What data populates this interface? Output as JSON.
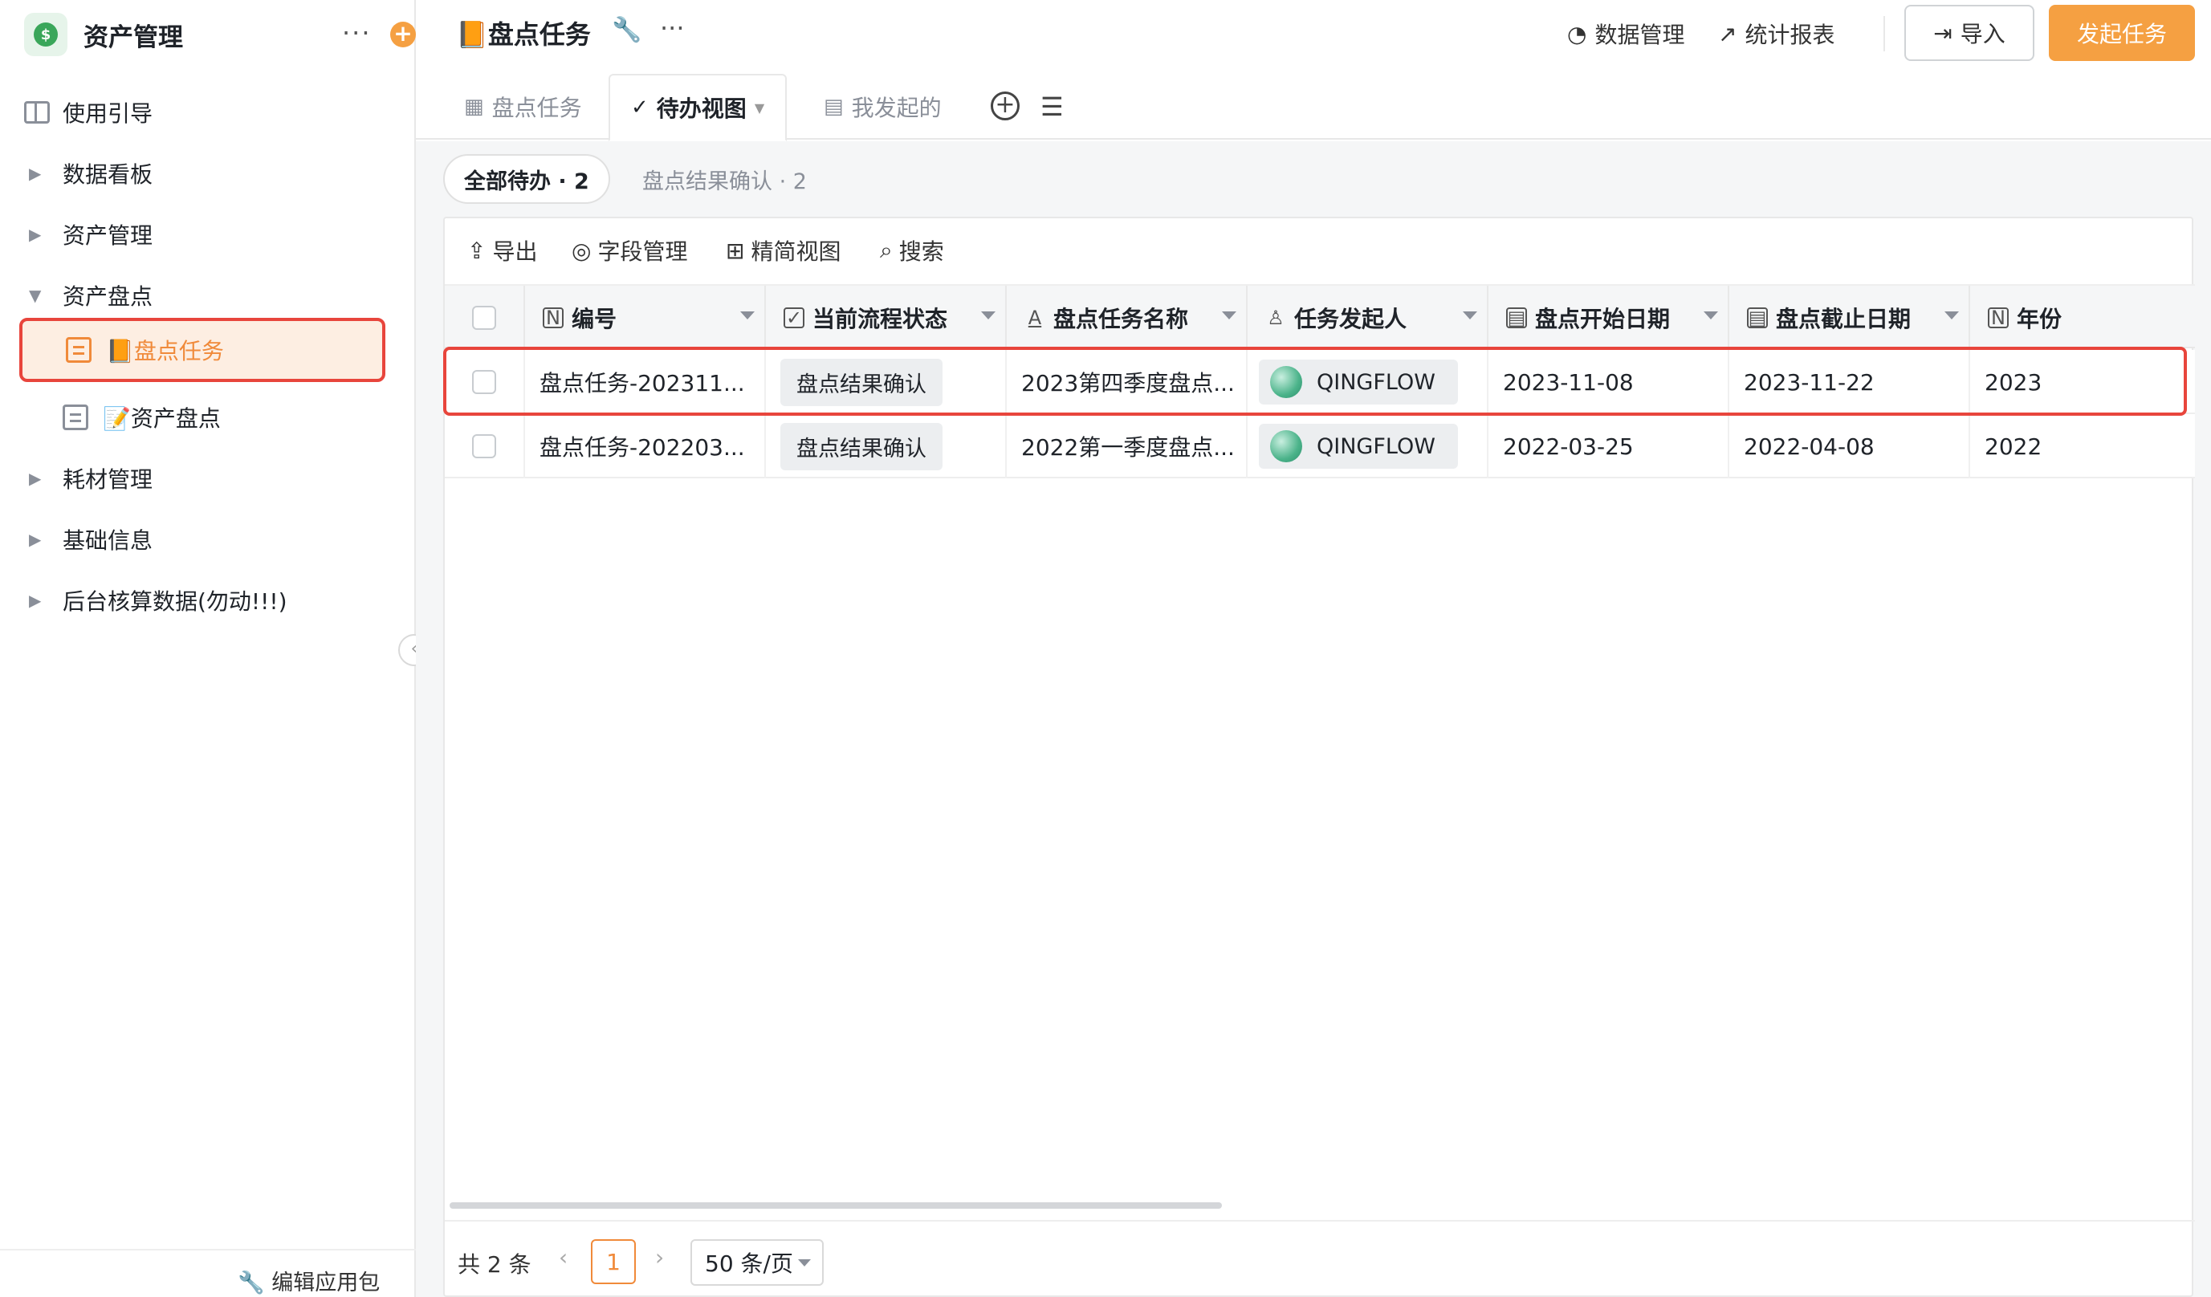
{
  "sidebar": {
    "app_title": "资产管理",
    "more": "···",
    "add": "+",
    "nav": [
      {
        "label": "使用引导"
      },
      {
        "label": "数据看板"
      },
      {
        "label": "资产管理"
      },
      {
        "label": "资产盘点"
      },
      {
        "label": "耗材管理"
      },
      {
        "label": "基础信息"
      },
      {
        "label": "后台核算数据(勿动!!!)"
      }
    ],
    "sub_items": [
      {
        "label": "📙盘点任务",
        "active": true
      },
      {
        "label": "📝资产盘点",
        "active": false
      }
    ],
    "collapse": "‹",
    "footer": "编辑应用包"
  },
  "header": {
    "title": "📙盘点任务",
    "more": "···",
    "links": {
      "data_mgmt": "数据管理",
      "stats": "统计报表"
    },
    "import": "导入",
    "start": "发起任务"
  },
  "tabs": [
    {
      "label": "盘点任务"
    },
    {
      "label": "待办视图",
      "active": true
    },
    {
      "label": "我发起的"
    }
  ],
  "filters": {
    "all": "全部待办 · 2",
    "confirm": "盘点结果确认 · 2"
  },
  "toolbar": {
    "export": "导出",
    "fields": "字段管理",
    "compact": "精简视图",
    "search": "搜索"
  },
  "table": {
    "columns": [
      "编号",
      "当前流程状态",
      "盘点任务名称",
      "任务发起人",
      "盘点开始日期",
      "盘点截止日期",
      "年份"
    ],
    "rows": [
      {
        "id": "盘点任务-202311...",
        "status": "盘点结果确认",
        "name": "2023第四季度盘点...",
        "initiator": "QINGFLOW",
        "start": "2023-11-08",
        "end": "2023-11-22",
        "year": "2023"
      },
      {
        "id": "盘点任务-202203...",
        "status": "盘点结果确认",
        "name": "2022第一季度盘点...",
        "initiator": "QINGFLOW",
        "start": "2022-03-25",
        "end": "2022-04-08",
        "year": "2022"
      }
    ]
  },
  "pager": {
    "total": "共 2 条",
    "prev": "‹",
    "next": "›",
    "page": "1",
    "size": "50 条/页"
  },
  "colors": {
    "accent": "#f5a042",
    "highlight": "#e8453c"
  }
}
